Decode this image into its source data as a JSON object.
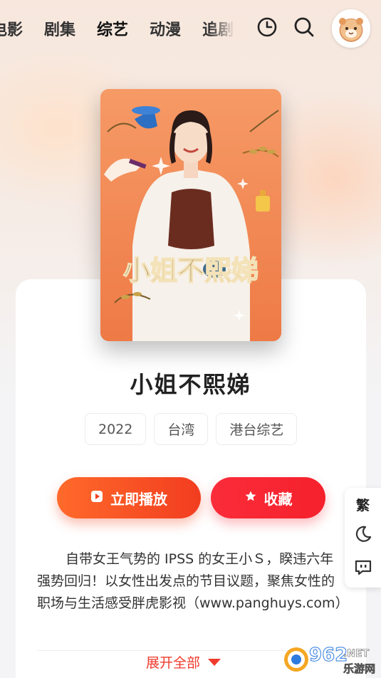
{
  "nav": {
    "tabs": [
      {
        "label": "电影"
      },
      {
        "label": "剧集"
      },
      {
        "label": "综艺",
        "active": true
      },
      {
        "label": "动漫"
      },
      {
        "label": "追剧"
      }
    ]
  },
  "poster": {
    "logo_text": "小姐不熙娣"
  },
  "show": {
    "title": "小姐不熙娣",
    "tags": [
      "2022",
      "台湾",
      "港台综艺"
    ],
    "play_label": "立即播放",
    "fav_label": "收藏",
    "description": "自带女王气势的 IPSS 的女王小Ｓ，睽违六年强势回归！以女性出发点的节目议题，聚焦女性的职场与生活感受胖虎影视（www.panghuys.com）",
    "expand_label": "展开全部"
  },
  "side": {
    "traditional_label": "繁"
  },
  "watermark": {
    "text_big": "962",
    "text_net": ".NET",
    "text_cn": "乐游网"
  },
  "colors": {
    "accent_orange": "#f23d20",
    "accent_red": "#f5212c",
    "tab_highlight": "#ffd84d"
  }
}
